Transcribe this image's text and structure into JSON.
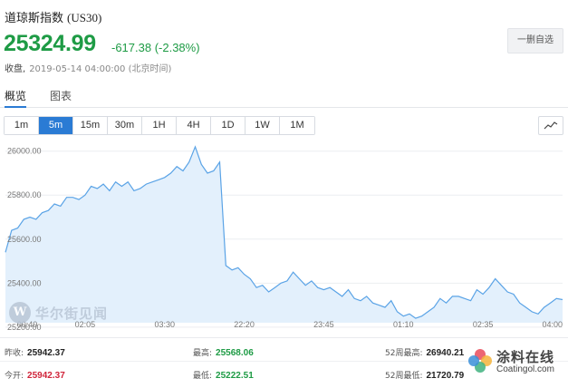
{
  "header": {
    "name": "道琼斯指数",
    "code": "(US30)",
    "price": "25324.99",
    "change": "-617.38 (-2.38%)",
    "close_label": "收盘,",
    "close_time": "2019-05-14 04:00:00 (北京时间)",
    "watch_button": "一删自选",
    "price_color": "#1e9b45"
  },
  "tabs": [
    {
      "label": "概览",
      "active": true
    },
    {
      "label": "图表",
      "active": false
    }
  ],
  "intervals": [
    {
      "label": "1m",
      "active": false
    },
    {
      "label": "5m",
      "active": true
    },
    {
      "label": "15m",
      "active": false
    },
    {
      "label": "30m",
      "active": false
    },
    {
      "label": "1H",
      "active": false
    },
    {
      "label": "4H",
      "active": false
    },
    {
      "label": "1D",
      "active": false
    },
    {
      "label": "1W",
      "active": false
    },
    {
      "label": "1M",
      "active": false
    }
  ],
  "chart_type_icon": "line-chart-icon",
  "chart_data": {
    "type": "area",
    "title": "",
    "xlabel": "",
    "ylabel": "",
    "ylim": [
      25220,
      26040
    ],
    "y_ticks": [
      "26000.00",
      "25800.00",
      "25600.00",
      "25400.00",
      "25200.00"
    ],
    "x_ticks": [
      "00:40",
      "02:05",
      "03:30",
      "22:20",
      "23:45",
      "01:10",
      "02:35",
      "04:00"
    ],
    "grid": true,
    "line_color": "#5aa3e6",
    "fill_color": "#e3f0fc",
    "series": [
      {
        "values": [
          25540,
          25640,
          25650,
          25690,
          25700,
          25690,
          25720,
          25730,
          25760,
          25750,
          25790,
          25790,
          25780,
          25800,
          25840,
          25830,
          25850,
          25820,
          25860,
          25840,
          25860,
          25820,
          25830,
          25850,
          25860,
          25870,
          25880,
          25900,
          25930,
          25910,
          25950,
          26020,
          25940,
          25900,
          25910,
          25950,
          25480,
          25460,
          25470,
          25440,
          25420,
          25380,
          25390,
          25360,
          25380,
          25400,
          25410,
          25450,
          25420,
          25390,
          25410,
          25380,
          25370,
          25380,
          25360,
          25340,
          25370,
          25330,
          25320,
          25340,
          25310,
          25300,
          25290,
          25320,
          25270,
          25250,
          25260,
          25240,
          25250,
          25270,
          25290,
          25330,
          25310,
          25340,
          25340,
          25330,
          25320,
          25370,
          25350,
          25380,
          25420,
          25390,
          25360,
          25350,
          25310,
          25290,
          25270,
          25260,
          25290,
          25310,
          25330,
          25325
        ]
      }
    ]
  },
  "watermark": {
    "logo_letter": "W",
    "text": "华尔街见闻"
  },
  "stats": {
    "prev_close_label": "昨收:",
    "prev_close_value": "25942.37",
    "open_label": "今开:",
    "open_value": "25942.37",
    "high_label": "最高:",
    "high_value": "25568.06",
    "low_label": "最低:",
    "low_value": "25222.51",
    "week52_high_label": "52周最高:",
    "week52_high_value": "26940.21",
    "week52_low_label": "52周最低:",
    "week52_low_value": "21720.79",
    "neutral_color": "#222222",
    "up_color": "#d0243a",
    "down_color": "#1e9b45"
  },
  "badge": {
    "main": "涂料在线",
    "sub": "Coatingol.com"
  }
}
